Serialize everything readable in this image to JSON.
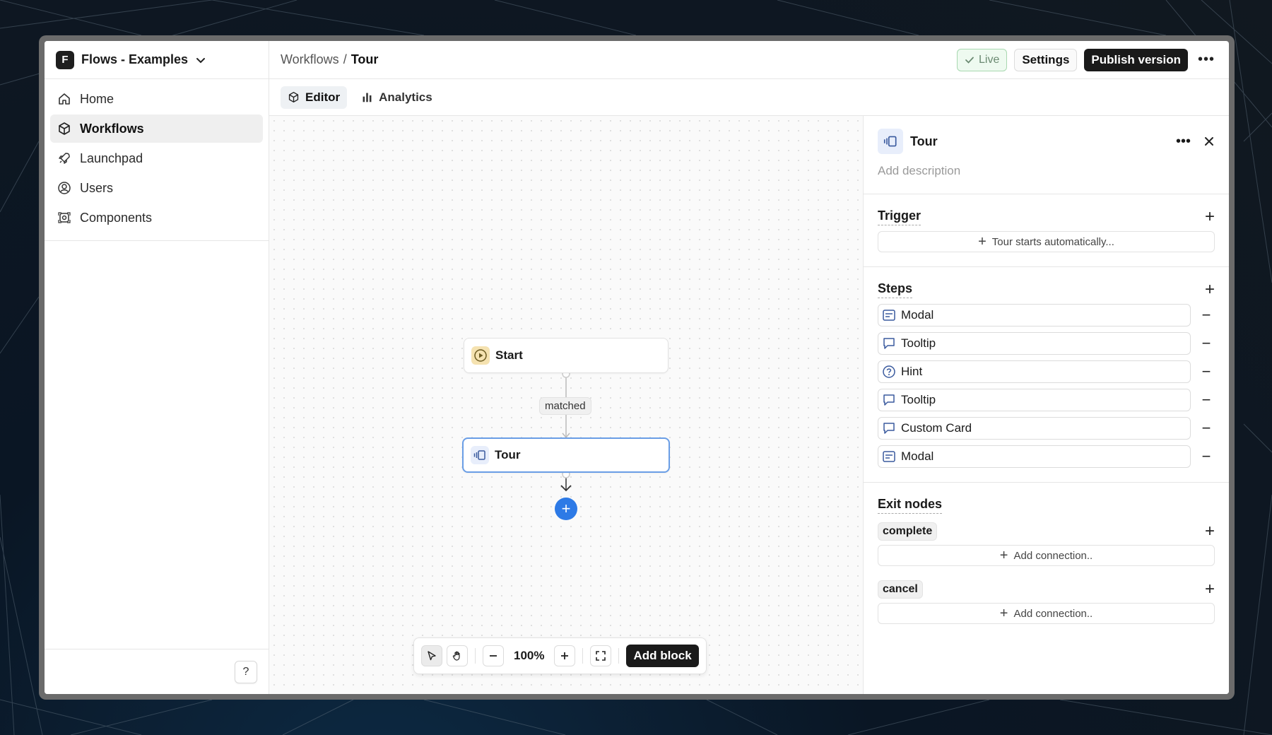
{
  "workspace": {
    "badge": "F",
    "name": "Flows - Examples"
  },
  "nav": [
    {
      "label": "Home",
      "icon": "home-icon"
    },
    {
      "label": "Workflows",
      "icon": "workflows-icon",
      "active": true
    },
    {
      "label": "Launchpad",
      "icon": "rocket-icon"
    },
    {
      "label": "Users",
      "icon": "user-icon"
    },
    {
      "label": "Components",
      "icon": "components-icon"
    }
  ],
  "help": {
    "label": "?"
  },
  "breadcrumb": {
    "parent": "Workflows",
    "separator": "/",
    "current": "Tour"
  },
  "top_actions": {
    "live": "Live",
    "settings": "Settings",
    "publish": "Publish version",
    "more": "•••"
  },
  "tabs": [
    {
      "label": "Editor",
      "active": true
    },
    {
      "label": "Analytics"
    }
  ],
  "canvas": {
    "start_node": "Start",
    "edge_label": "matched",
    "tour_node": "Tour",
    "add_node": "+"
  },
  "toolbar": {
    "zoom": "100%",
    "add_block": "Add block"
  },
  "panel": {
    "title": "Tour",
    "description_placeholder": "Add description",
    "trigger": {
      "title": "Trigger",
      "action": "Tour starts automatically..."
    },
    "steps": {
      "title": "Steps",
      "items": [
        {
          "label": "Modal",
          "icon": "modal-icon"
        },
        {
          "label": "Tooltip",
          "icon": "tooltip-icon"
        },
        {
          "label": "Hint",
          "icon": "hint-icon"
        },
        {
          "label": "Tooltip",
          "icon": "tooltip-icon"
        },
        {
          "label": "Custom Card",
          "icon": "tooltip-icon"
        },
        {
          "label": "Modal",
          "icon": "modal-icon"
        }
      ]
    },
    "exit_nodes": {
      "title": "Exit nodes",
      "items": [
        {
          "label": "complete",
          "action": "Add connection.."
        },
        {
          "label": "cancel",
          "action": "Add connection.."
        }
      ]
    }
  },
  "colors": {
    "accent": "#2d7ae6",
    "live_green": "#a8d8b0",
    "dark": "#1a1a1a"
  }
}
